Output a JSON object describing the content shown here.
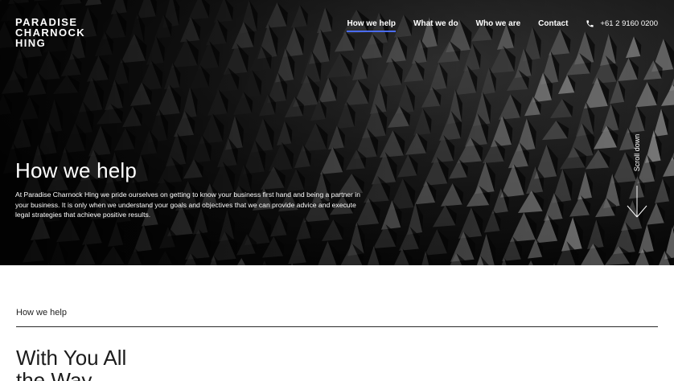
{
  "brand": {
    "logo_lines": [
      "PARADISE",
      "CHARNOCK",
      "HING"
    ]
  },
  "nav": {
    "items": [
      {
        "label": "How we help",
        "active": true
      },
      {
        "label": "What we do",
        "active": false
      },
      {
        "label": "Who we are",
        "active": false
      },
      {
        "label": "Contact",
        "active": false
      }
    ],
    "phone": "+61 2 9160 0200",
    "phone_icon": "phone-icon"
  },
  "hero": {
    "title": "How we help",
    "text": "At Paradise Charnock Hing we pride ourselves on getting to know your business first hand and being a partner in your business. It is only when we understand your goals and objectives that we can provide advice and execute legal strategies that achieve positive results.",
    "scroll_label": "Scroll down",
    "scroll_icon": "arrow-down-icon"
  },
  "section": {
    "label": "How we help",
    "headline_lines": [
      "With You All",
      "the Way"
    ]
  },
  "colors": {
    "hero_background": "#0d0d0d",
    "text_light": "#ffffff",
    "nav_active_underline": "#4a6cf7",
    "text_dark": "#1c1c1c"
  }
}
